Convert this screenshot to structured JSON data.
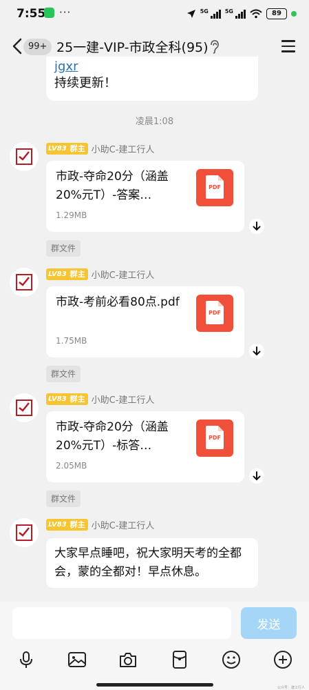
{
  "status_bar": {
    "time": "7:55",
    "dots": "···",
    "signal1": "5G",
    "signal2": "5G",
    "battery": "89"
  },
  "header": {
    "badge": "99+",
    "title": "25一建-VIP-市政全科(95)"
  },
  "messages": {
    "partial": {
      "link": "jgxr",
      "text": "持续更新！"
    },
    "time_divider": "凌晨1:08",
    "sender": {
      "level": "LV83",
      "role": "群主",
      "name": "小助C-建工行人"
    },
    "files": [
      {
        "name": "市政-夺命20分（涵盖20%元T）-答案…",
        "size": "1.29MB",
        "icon_label": "PDF"
      },
      {
        "name": "市政-考前必看80点.pdf",
        "size": "1.75MB",
        "icon_label": "PDF"
      },
      {
        "name": "市政-夺命20分（涵盖20%元T）-标答…",
        "size": "2.05MB",
        "icon_label": "PDF"
      }
    ],
    "group_file_tag": "群文件",
    "final_text": "大家早点睡吧，祝大家明天考的全都会，蒙的全都对！早点休息。"
  },
  "input": {
    "placeholder": "",
    "send_label": "发送"
  },
  "toolbar_icons": [
    "microphone-icon",
    "image-icon",
    "camera-icon",
    "red-packet-icon",
    "emoji-icon",
    "plus-icon"
  ],
  "watermark": "公众号：建工行人",
  "colors": {
    "background": "#f1f1f1",
    "pdf_red": "#f0503a",
    "send_button": "#a6d6f7",
    "level_badge": "#f7c531",
    "link": "#2a6fb8"
  }
}
